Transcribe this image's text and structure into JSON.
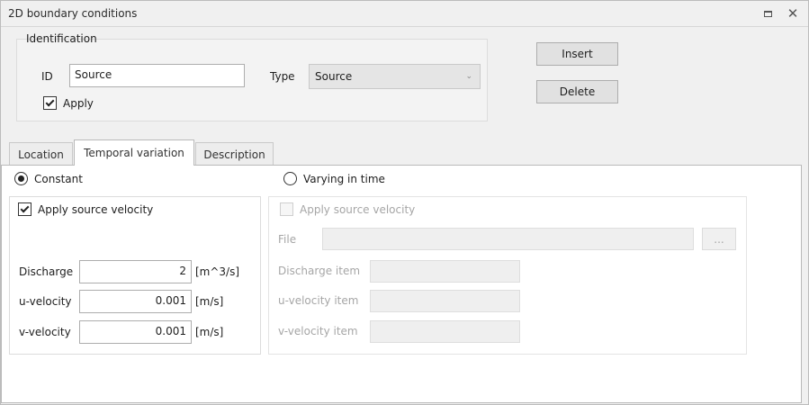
{
  "window": {
    "title": "2D boundary conditions",
    "restore_icon": "restore-icon",
    "close_icon": "close-icon"
  },
  "identification": {
    "group_title": "Identification",
    "id_label": "ID",
    "id_value": "Source",
    "type_label": "Type",
    "type_value": "Source",
    "apply_label": "Apply",
    "apply_checked": true
  },
  "actions": {
    "insert_label": "Insert",
    "delete_label": "Delete"
  },
  "tabs": [
    {
      "label": "Location",
      "active": false
    },
    {
      "label": "Temporal variation",
      "active": true
    },
    {
      "label": "Description",
      "active": false
    }
  ],
  "temporal": {
    "constant_label": "Constant",
    "constant_selected": true,
    "varying_label": "Varying in time",
    "varying_selected": false
  },
  "constant_panel": {
    "apply_velocity_label": "Apply source velocity",
    "apply_velocity_checked": true,
    "discharge_label": "Discharge",
    "discharge_value": "2",
    "discharge_unit": "[m^3/s]",
    "u_label": "u-velocity",
    "u_value": "0.001",
    "u_unit": "[m/s]",
    "v_label": "v-velocity",
    "v_value": "0.001",
    "v_unit": "[m/s]"
  },
  "varying_panel": {
    "apply_velocity_label": "Apply source velocity",
    "apply_velocity_checked": false,
    "file_label": "File",
    "file_value": "",
    "browse_label": "...",
    "discharge_item_label": "Discharge item",
    "u_item_label": "u-velocity item",
    "v_item_label": "v-velocity item"
  }
}
